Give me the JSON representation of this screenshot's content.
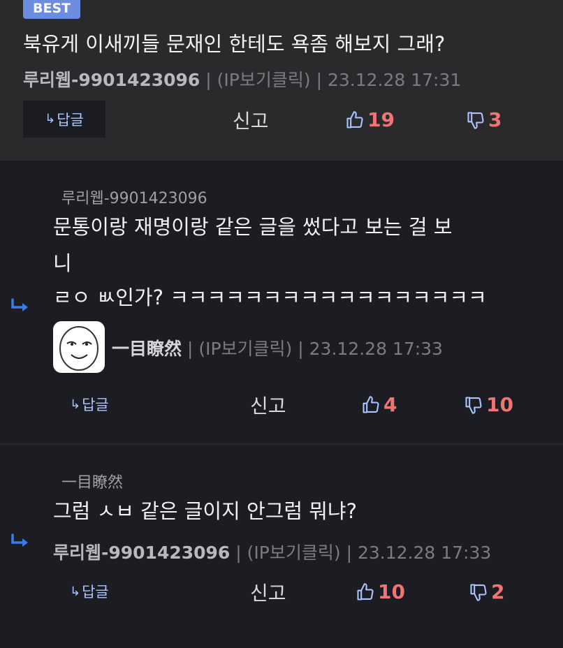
{
  "best": {
    "badge": "BEST",
    "text": "북유게 이새끼들 문재인 한테도 욕좀 해보지 그래?",
    "author": "루리웹-9901423096",
    "ip": "(IP보기클릭)",
    "time": "23.12.28 17:31",
    "reply_label": "답글",
    "report_label": "신고",
    "upvotes": "19",
    "downvotes": "3"
  },
  "comments": [
    {
      "parent": "루리웹-9901423096",
      "line1": "문통이랑 재명이랑 같은 글을 썼다고 보는 걸 보",
      "line2": "니",
      "line3": "ㄹㅇ ㅄ인가? ㅋㅋㅋㅋㅋㅋㅋㅋㅋㅋㅋㅋㅋㅋㅋㅋㅋ",
      "author": "一目瞭然",
      "ip": "(IP보기클릭)",
      "time": "23.12.28 17:33",
      "reply_label": "답글",
      "report_label": "신고",
      "upvotes": "4",
      "downvotes": "10"
    },
    {
      "parent": "一目瞭然",
      "line1": "그럼 ㅅㅂ 같은 글이지 안그럼 뭐냐?",
      "author": "루리웹-9901423096",
      "ip": "(IP보기클릭)",
      "time": "23.12.28 17:33",
      "reply_label": "답글",
      "report_label": "신고",
      "upvotes": "10",
      "downvotes": "2"
    }
  ],
  "colors": {
    "accent": "#6a8de0",
    "vote": "#ef7474",
    "icon": "#a9c4ff"
  },
  "icons": [
    "reply-arrow-icon",
    "thumbs-up-icon",
    "thumbs-down-icon",
    "avatar-face-icon"
  ]
}
